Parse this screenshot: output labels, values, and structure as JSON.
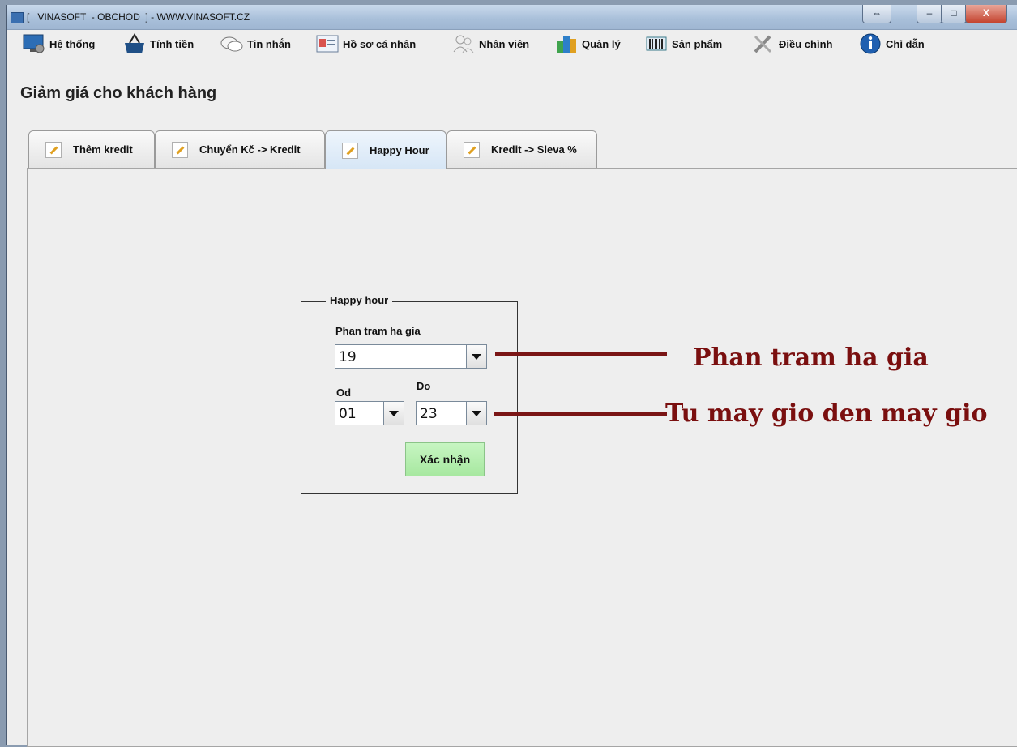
{
  "window": {
    "title": "[   VINASOFT  - OBCHOD  ] - WWW.VINASOFT.CZ",
    "controls": [
      "⇔",
      "–",
      "□",
      "X"
    ]
  },
  "menu": {
    "items": [
      {
        "label": "Hệ thống",
        "icon": "monitor-gear-icon"
      },
      {
        "label": "Tính tiền",
        "icon": "shopping-basket-icon"
      },
      {
        "label": "Tin nhắn",
        "icon": "chat-bubbles-icon"
      },
      {
        "label": "Hồ sơ cá nhân",
        "icon": "id-card-icon"
      },
      {
        "label": "Nhân viên",
        "icon": "users-icon"
      },
      {
        "label": "Quản lý",
        "icon": "buildings-icon"
      },
      {
        "label": "Sản phẩm",
        "icon": "barcode-icon"
      },
      {
        "label": "Điều chỉnh",
        "icon": "tools-icon"
      },
      {
        "label": "Chỉ dẫn",
        "icon": "info-icon"
      }
    ]
  },
  "page": {
    "title": "Giảm giá cho khách hàng"
  },
  "tabs": [
    {
      "label": "Thêm kredit",
      "active": false
    },
    {
      "label": "Chuyển Kč -> Kredit",
      "active": false
    },
    {
      "label": "Happy Hour",
      "active": true
    },
    {
      "label": "Kredit -> Sleva %",
      "active": false
    }
  ],
  "happy_hour": {
    "legend": "Happy hour",
    "percent_label": "Phan tram ha gia",
    "percent_value": "19",
    "from_label": "Od",
    "from_value": "01",
    "to_label": "Do",
    "to_value": "23",
    "confirm_label": "Xác nhận"
  },
  "annotations": {
    "percent": "Phan tram ha gia",
    "time_range": "Tu may gio den may gio"
  },
  "colors": {
    "annotation": "#7a0f0f",
    "confirm_button": "#b8efb2",
    "active_tab": "#dbe8f5"
  }
}
